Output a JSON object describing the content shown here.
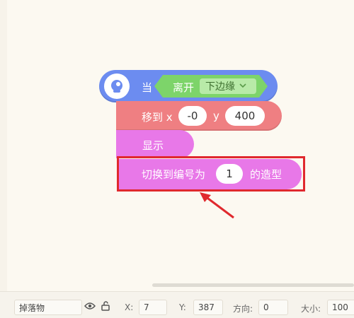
{
  "workspace": {
    "hat_block": {
      "label": "当",
      "event_label": "离开",
      "edge_value": "下边缘"
    },
    "motion_block": {
      "label": "移到 x",
      "x_value": "-0",
      "y_label": "y",
      "y_value": "400"
    },
    "show_block": {
      "label": "显示"
    },
    "costume_block": {
      "label_before": "切换到编号为",
      "costume_value": "1",
      "label_after": "的造型"
    }
  },
  "sprite_bar": {
    "sprite_name": "掉落物",
    "x_label": "X:",
    "x_value": "7",
    "y_label": "Y:",
    "y_value": "387",
    "direction_label": "方向:",
    "direction_value": "0",
    "size_label": "大小:",
    "size_value": "100"
  },
  "colors": {
    "event": "#6c8cf0",
    "sensing_slot": "#7dd46a",
    "motion": "#ef7f82",
    "looks": "#e878e8",
    "highlight": "#e0292e"
  },
  "icons": [
    "sprite-avatar-icon",
    "chevron-down-icon",
    "eye-icon",
    "unlock-icon",
    "red-arrow-annotation"
  ]
}
